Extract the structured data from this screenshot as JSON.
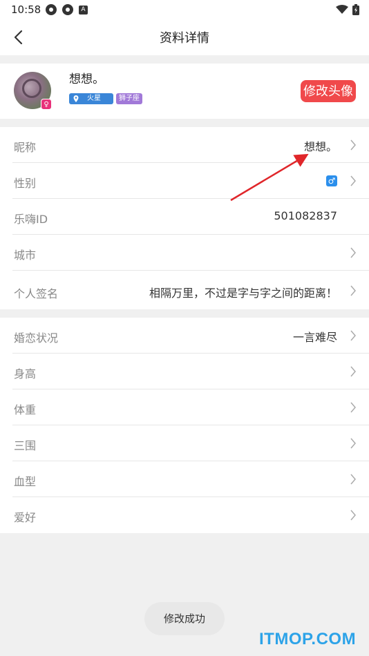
{
  "statusbar": {
    "time": "10:58"
  },
  "header": {
    "title": "资料详情"
  },
  "profile": {
    "nickname": "想想。",
    "planet_tag": "火星",
    "zodiac_tag": "狮子座",
    "edit_avatar_label": "修改头像"
  },
  "section1": {
    "rows": [
      {
        "label": "昵称",
        "value": "想想。"
      },
      {
        "label": "性别",
        "value": ""
      },
      {
        "label": "乐嗨ID",
        "value": "501082837"
      },
      {
        "label": "城市",
        "value": ""
      },
      {
        "label": "个人签名",
        "value": "相隔万里，不过是字与字之间的距离！"
      }
    ]
  },
  "section2": {
    "rows": [
      {
        "label": "婚恋状况",
        "value": "一言难尽"
      },
      {
        "label": "身高",
        "value": ""
      },
      {
        "label": "体重",
        "value": ""
      },
      {
        "label": "三围",
        "value": ""
      },
      {
        "label": "血型",
        "value": ""
      },
      {
        "label": "爱好",
        "value": ""
      }
    ]
  },
  "toast": {
    "text": "修改成功"
  },
  "watermark": {
    "text": "ITMOP.COM"
  },
  "colors": {
    "accent_red": "#f0494b",
    "gender_blue": "#2b8fec",
    "planet_blue": "#3a86d8",
    "zodiac_purple": "#a179d8",
    "watermark_blue": "#2da3e8"
  },
  "icons": {
    "gender": "male-icon",
    "back": "back-arrow-icon",
    "row": "chevron-right-icon"
  }
}
